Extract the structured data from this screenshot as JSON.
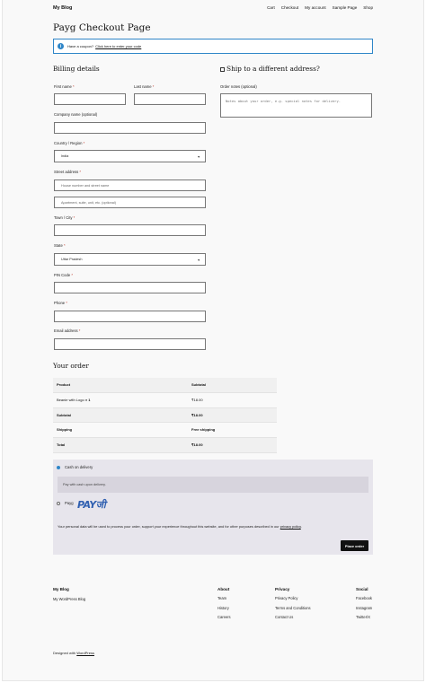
{
  "header": {
    "site_title": "My Blog",
    "nav": [
      "Cart",
      "Checkout",
      "My account",
      "Sample Page",
      "Shop"
    ]
  },
  "page_title": "Payg Checkout Page",
  "coupon": {
    "text": "Have a coupon?",
    "link": "Click here to enter your code"
  },
  "billing": {
    "heading": "Billing details",
    "first_name_label": "First name",
    "last_name_label": "Last name",
    "company_label": "Company name (optional)",
    "country_label": "Country / Region",
    "country_value": "India",
    "street_label": "Street address",
    "street_placeholder": "House number and street name",
    "street2_placeholder": "Apartment, suite, unit, etc. (optional)",
    "town_label": "Town / City",
    "state_label": "State",
    "state_value": "Uttar Pradesh",
    "pin_label": "PIN Code",
    "phone_label": "Phone",
    "email_label": "Email address",
    "required_mark": "*"
  },
  "shipping": {
    "heading": "Ship to a different address?",
    "notes_label": "Order notes (optional)",
    "notes_placeholder": "Notes about your order, e.g. special notes for delivery."
  },
  "order": {
    "heading": "Your order",
    "col_product": "Product",
    "col_subtotal": "Subtotal",
    "item_name": "Beanie with Logo",
    "item_qty": "× 1",
    "item_price": "₹18.00",
    "subtotal_label": "Subtotal",
    "subtotal_value": "₹18.00",
    "shipping_label": "Shipping",
    "shipping_value": "Free shipping",
    "total_label": "Total",
    "total_value": "₹18.00"
  },
  "payment": {
    "cod_label": "Cash on delivery",
    "cod_desc": "Pay with cash upon delivery.",
    "payg_label": "Payg",
    "payg_logo": "PAYजी",
    "privacy_text": "Your personal data will be used to process your order, support your experience throughout this website, and for other purposes described in our",
    "privacy_link": "privacy policy",
    "privacy_end": ".",
    "place_order": "Place order",
    "accent": "#2f86c8"
  },
  "footer": {
    "blog_title": "My Blog",
    "blog_tagline": "My WordPress Blog",
    "columns": [
      {
        "title": "About",
        "links": [
          "Team",
          "History",
          "Careers"
        ]
      },
      {
        "title": "Privacy",
        "links": [
          "Privacy Policy",
          "Terms and Conditions",
          "Contact Us"
        ]
      },
      {
        "title": "Social",
        "links": [
          "Facebook",
          "Instagram",
          "Twitter/X"
        ]
      }
    ],
    "designed_with": "Designed with",
    "designed_link": "WordPress"
  }
}
